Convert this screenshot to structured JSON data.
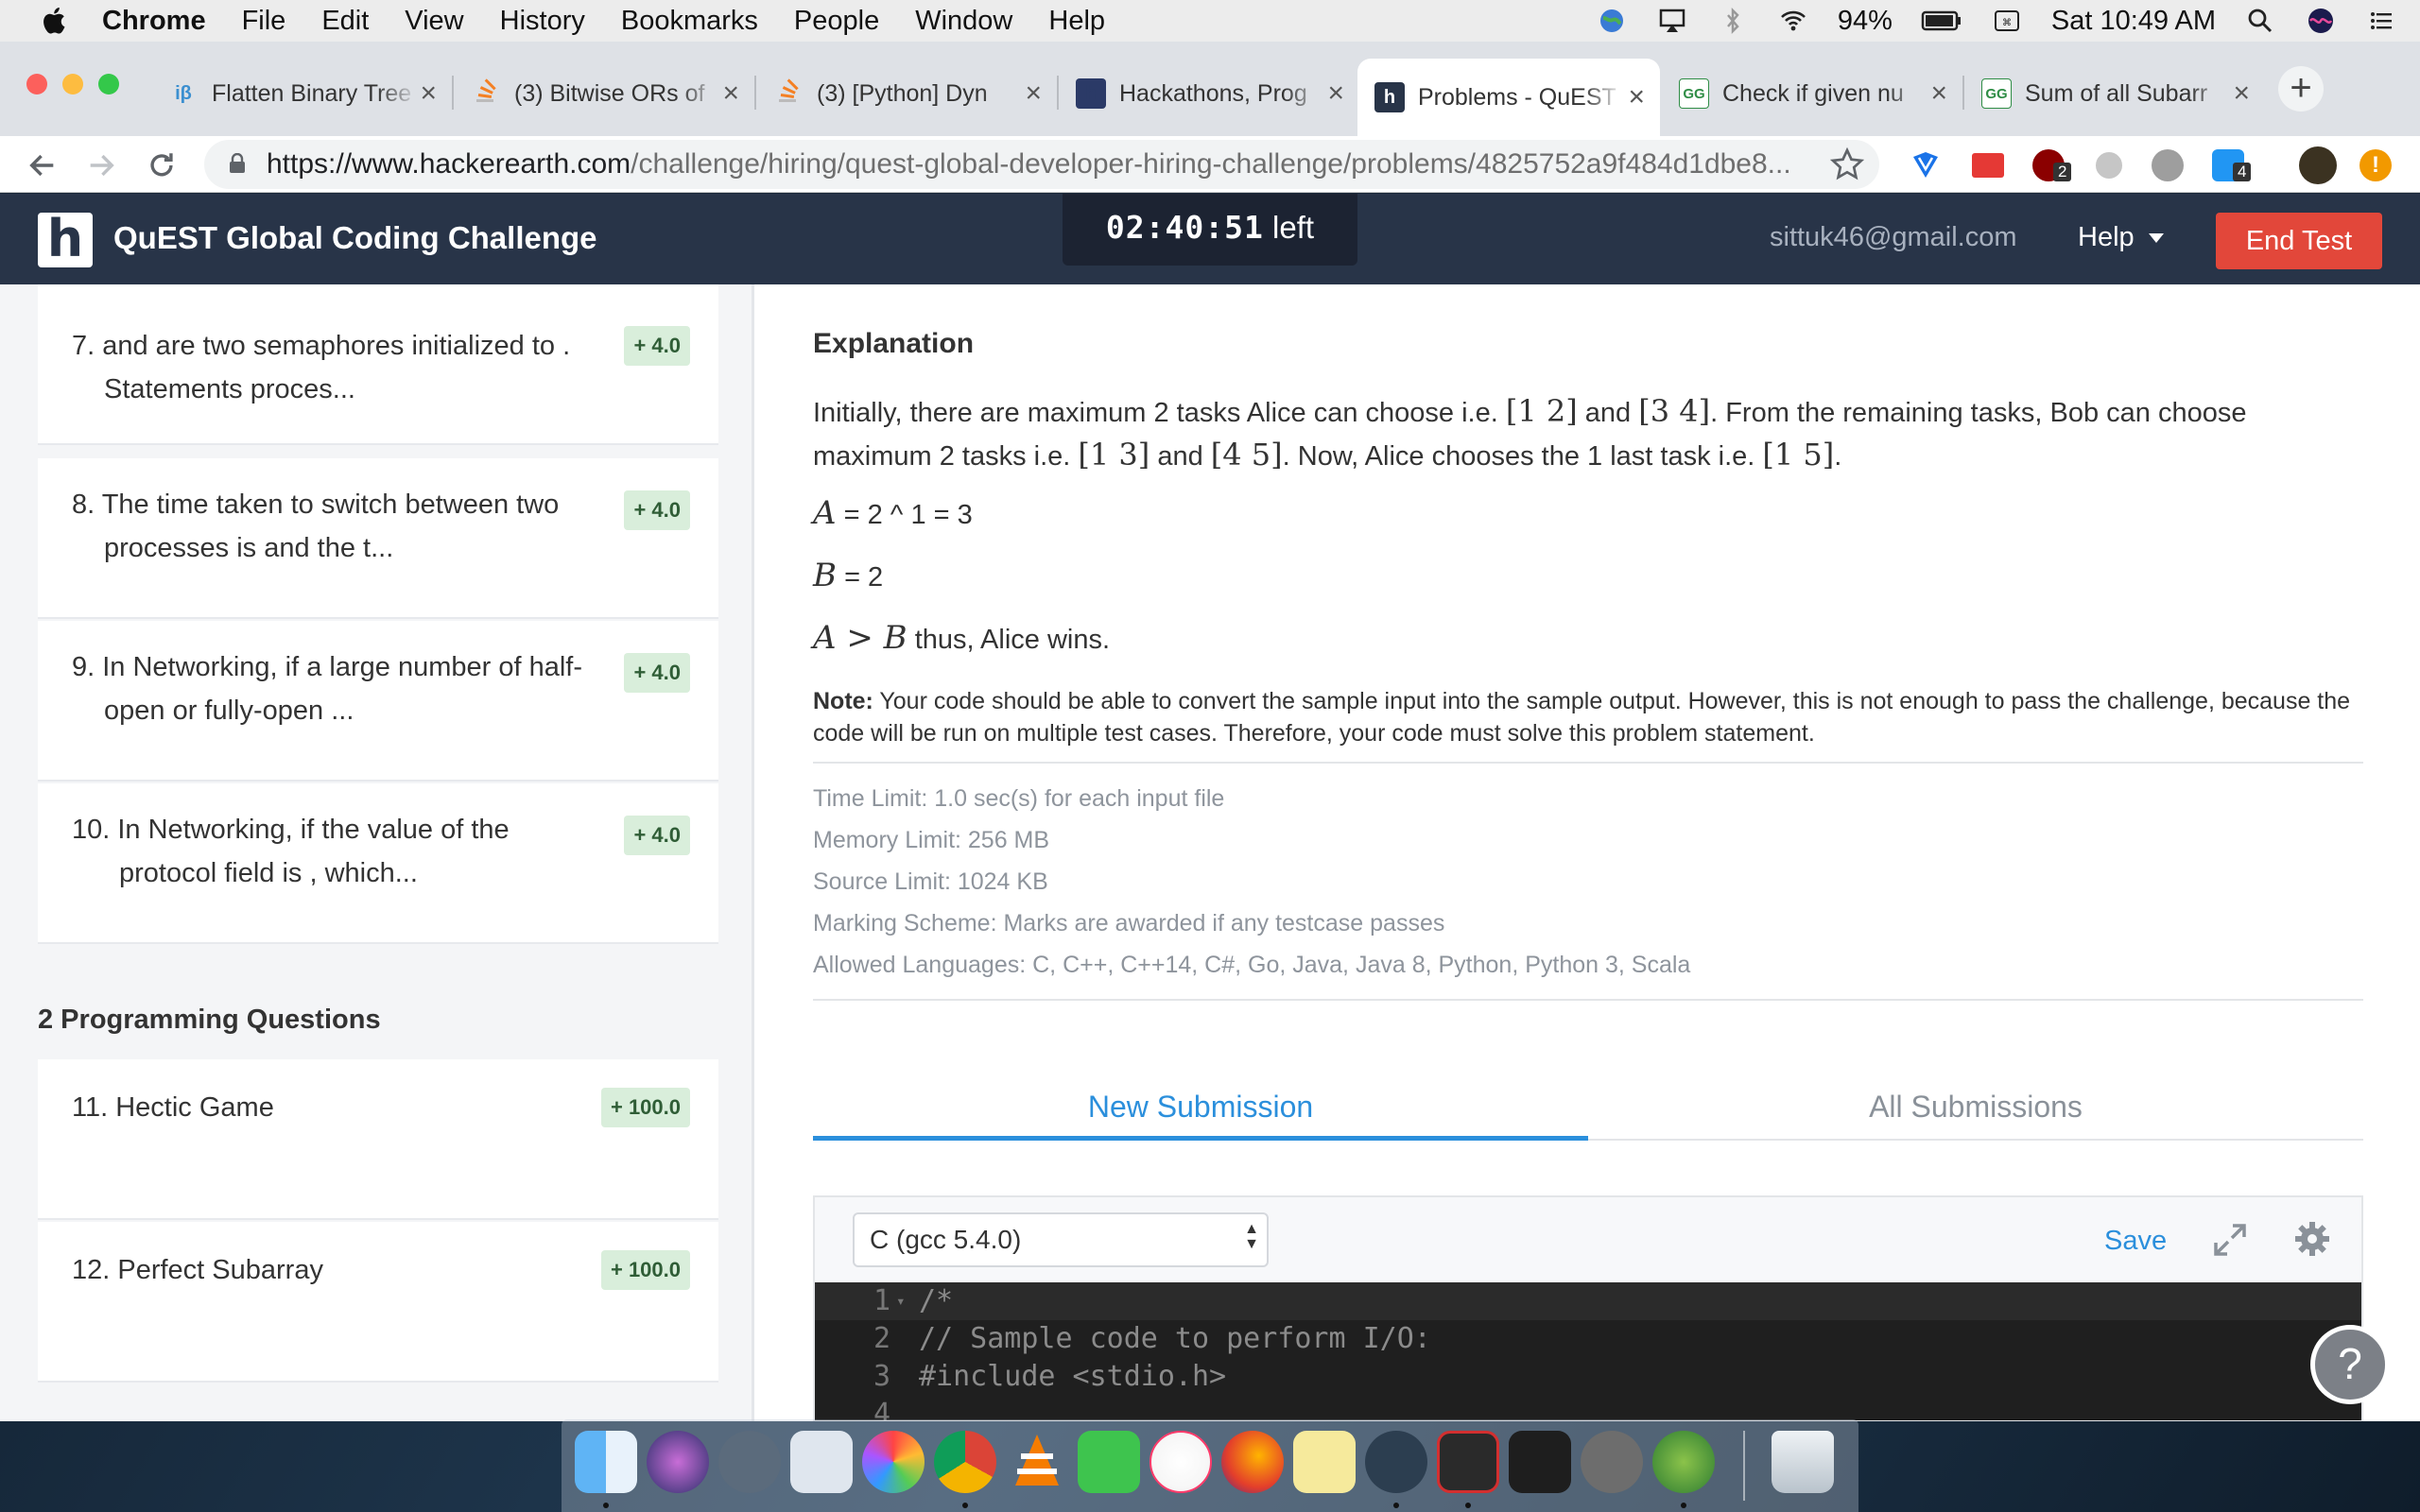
{
  "menubar": {
    "app_name": "Chrome",
    "items": [
      "File",
      "Edit",
      "View",
      "History",
      "Bookmarks",
      "People",
      "Window",
      "Help"
    ],
    "battery": "94%",
    "clock": "Sat 10:49 AM"
  },
  "tabs": [
    {
      "title": "Flatten Binary Tree",
      "favicon": "iβ"
    },
    {
      "title": "(3) Bitwise ORs of",
      "favicon": "so"
    },
    {
      "title": "(3) [Python] Dyn",
      "favicon": "so"
    },
    {
      "title": "Hackathons, Prog",
      "favicon": "h"
    },
    {
      "title": "Problems - QuEST",
      "favicon": "h"
    },
    {
      "title": "Check if given nu",
      "favicon": "GG"
    },
    {
      "title": "Sum of all Subarr",
      "favicon": "GG"
    }
  ],
  "address_bar": {
    "host": "https://www.hackerearth.com",
    "path": "/challenge/hiring/quest-global-developer-hiring-challenge/problems/4825752a9f484d1dbe8..."
  },
  "extensions": {
    "badge_1": "2",
    "badge_2": "4"
  },
  "header": {
    "logo_letter": "h",
    "title": "QuEST Global Coding Challenge",
    "timer_value": "02:40:51",
    "timer_suffix": "left",
    "email": "sittuk46@gmail.com",
    "help_label": "Help",
    "end_test_label": "End Test"
  },
  "sidebar": {
    "questions": [
      {
        "text": "7. and are two semaphores initialized to . Statements proces...",
        "score": "+ 4.0"
      },
      {
        "text": "8. The time taken to switch between two processes is and the t...",
        "score": "+ 4.0"
      },
      {
        "text": "9. In Networking, if a large number of half-open or fully-open ...",
        "score": "+ 4.0"
      },
      {
        "text": "10. In Networking, if the value of the protocol field is , which...",
        "score": "+ 4.0"
      }
    ],
    "programming_title": "2 Programming Questions",
    "programming": [
      {
        "text": "11. Hectic Game",
        "score": "+ 100.0"
      },
      {
        "text": "12. Perfect Subarray",
        "score": "+ 100.0"
      }
    ]
  },
  "problem": {
    "explanation_heading": "Explanation",
    "para_1": "Initially, there are maximum 2 tasks Alice can choose i.e.",
    "para_m1": "[1 2]",
    "para_and1": "and",
    "para_m2": "[3 4]",
    "para_2": ". From the remaining tasks, Bob can choose maximum 2 tasks i.e.",
    "para_m3": "[1 3]",
    "para_and2": "and",
    "para_m4": "[4 5]",
    "para_3": ". Now, Alice chooses the 1 last task i.e.",
    "para_m5": "[1 5]",
    "para_end": ".",
    "eq_a_var": "A",
    "eq_a_rest": "= 2 ^ 1 = 3",
    "eq_b_var": "B",
    "eq_b_rest": "= 2",
    "eq_c_math": "A > B",
    "eq_c_rest": "thus, Alice wins.",
    "note_label": "Note:",
    "note_text": "Your code should be able to convert the sample input into the sample output. However, this is not enough to pass the challenge, because the code will be run on multiple test cases. Therefore, your code must solve this problem statement.",
    "time_limit": "Time Limit: 1.0 sec(s) for each input file",
    "memory_limit": "Memory Limit: 256 MB",
    "source_limit": "Source Limit: 1024 KB",
    "marking_scheme": "Marking Scheme: Marks are awarded if any testcase passes",
    "allowed_languages": "Allowed Languages: C, C++, C++14, C#, Go, Java, Java 8, Python, Python 3, Scala"
  },
  "submission_tabs": {
    "new": "New Submission",
    "all": "All Submissions"
  },
  "editor": {
    "language": "C (gcc 5.4.0)",
    "save_label": "Save",
    "lines": [
      {
        "num": "1",
        "text": "/*"
      },
      {
        "num": "2",
        "text": "// Sample code to perform I/O:"
      },
      {
        "num": "3",
        "text": "#include <stdio.h>"
      },
      {
        "num": "4",
        "text": ""
      }
    ]
  },
  "help_fab": "?",
  "colors": {
    "accent_blue": "#2b8fdc",
    "end_test_red": "#e2473a",
    "header_navy": "#283448",
    "badge_green": "#d9eedb"
  }
}
